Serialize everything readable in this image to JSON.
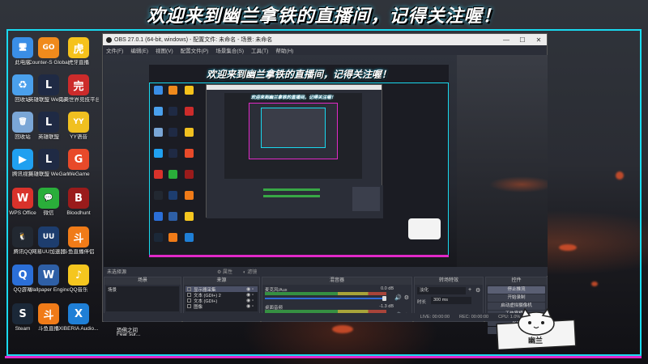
{
  "banner": {
    "text": "欢迎来到幽兰拿铁的直播间，记得关注喔！"
  },
  "desktop_icons": [
    {
      "label": "此电脑",
      "color": "#3a8ee6",
      "glyph": "🖥"
    },
    {
      "label": "Counter-S Global Off",
      "color": "#f08a1c",
      "glyph": "GO"
    },
    {
      "label": "虎牙直播",
      "color": "#f5c21b",
      "glyph": "虎"
    },
    {
      "label": "回收站",
      "color": "#4aa0ec",
      "glyph": "♻"
    },
    {
      "label": "英雄联盟 WeGame版",
      "color": "#1f2a44",
      "glyph": "L"
    },
    {
      "label": "完美世界竞技平台",
      "color": "#cc2b2b",
      "glyph": "完"
    },
    {
      "label": "回收站",
      "color": "#7aa6d6",
      "glyph": "🗑"
    },
    {
      "label": "英雄联盟",
      "color": "#1f2a44",
      "glyph": "L"
    },
    {
      "label": "YY语音",
      "color": "#f0c020",
      "glyph": "YY"
    },
    {
      "label": "腾讯视频",
      "color": "#20a0f0",
      "glyph": "▶"
    },
    {
      "label": "英雄联盟 WeGame版",
      "color": "#1f2a44",
      "glyph": "L"
    },
    {
      "label": "WeGame",
      "color": "#e84a2a",
      "glyph": "G"
    },
    {
      "label": "WPS Office",
      "color": "#d9322b",
      "glyph": "W"
    },
    {
      "label": "微信",
      "color": "#2aae3a",
      "glyph": "💬"
    },
    {
      "label": "Bloodhunt",
      "color": "#9a1b1b",
      "glyph": "B"
    },
    {
      "label": "腾讯QQ",
      "color": "#222831",
      "glyph": "🐧"
    },
    {
      "label": "网易UU加速器",
      "color": "#1d3d6e",
      "glyph": "UU"
    },
    {
      "label": "斗鱼直播伴侣",
      "color": "#f07b18",
      "glyph": "斗"
    },
    {
      "label": "QQ游戏",
      "color": "#2b6fd8",
      "glyph": "Q"
    },
    {
      "label": "Wallpaper Engine:...",
      "color": "#2e5fa6",
      "glyph": "W"
    },
    {
      "label": "QQ音乐",
      "color": "#f5c61f",
      "glyph": "♪"
    },
    {
      "label": "Steam",
      "color": "#1b2838",
      "glyph": "S"
    },
    {
      "label": "斗鱼直播",
      "color": "#f07b18",
      "glyph": "斗"
    },
    {
      "label": "XIBERIA Audio...",
      "color": "#1f7fd6",
      "glyph": "X"
    }
  ],
  "taskbar": {
    "item1": "恐佛之间",
    "item2": "Fear sur..."
  },
  "obs": {
    "title": "OBS 27.0.1 (64-bit, windows) - 配置文件: 未命名 - 场景: 未命名",
    "menu": [
      "文件(F)",
      "编辑(E)",
      "视图(V)",
      "配置文件(P)",
      "场景集合(S)",
      "工具(T)",
      "帮助(H)"
    ],
    "no_source": "未选择源",
    "props": "属性",
    "filters": "滤镜",
    "docks": {
      "scenes": "场景",
      "sources": "来源",
      "mixer": "混音器",
      "transitions": "转场特效",
      "controls": "控件"
    },
    "scene_item": "场景",
    "sources": [
      {
        "label": "显示器采集"
      },
      {
        "label": "文本 (GDI+) 2"
      },
      {
        "label": "文本 (GDI+)"
      },
      {
        "label": "图像"
      }
    ],
    "mixer_rows": [
      {
        "name": "麦克风/Aux",
        "db": "0.0 dB"
      },
      {
        "name": "桌面音频",
        "db": "-1.3 dB"
      }
    ],
    "transition": {
      "type": "淡化",
      "duration_label": "时长",
      "duration": "300 ms"
    },
    "controls": [
      "停止推流",
      "开始录制",
      "启动虚拟摄像机",
      "工作室模式",
      "设置",
      "退出"
    ],
    "status": {
      "live": "LIVE: 00:00:00",
      "rec": "REC: 00:00:00",
      "cpu": "CPU: 1.0%, 60.00 fps"
    }
  },
  "mascot": {
    "text": "幽兰"
  },
  "colors": {
    "cyan": "#19d9ef",
    "magenta": "#e129c8",
    "obs_bg": "#2b2e38"
  }
}
